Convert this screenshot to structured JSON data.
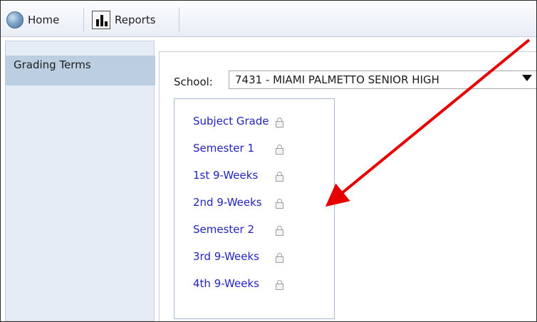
{
  "toolbar": {
    "home_label": "Home",
    "reports_label": "Reports"
  },
  "sidebar": {
    "items": [
      {
        "label": "Grading Terms",
        "selected": true
      }
    ]
  },
  "main": {
    "school_label": "School:",
    "school_value": "7431 - MIAMI PALMETTO SENIOR HIGH",
    "terms": [
      {
        "label": "Subject Grade",
        "icon": "lock-icon"
      },
      {
        "label": "Semester 1",
        "icon": "lock-icon"
      },
      {
        "label": "1st 9-Weeks",
        "icon": "lock-icon"
      },
      {
        "label": "2nd 9-Weeks",
        "icon": "lock-icon"
      },
      {
        "label": "Semester 2",
        "icon": "lock-icon"
      },
      {
        "label": "3rd 9-Weeks",
        "icon": "lock-icon"
      },
      {
        "label": "4th 9-Weeks",
        "icon": "lock-icon"
      }
    ]
  },
  "colors": {
    "link": "#2323bf",
    "selected_nav": "#bccfe2",
    "annotation_arrow": "#e60000"
  }
}
